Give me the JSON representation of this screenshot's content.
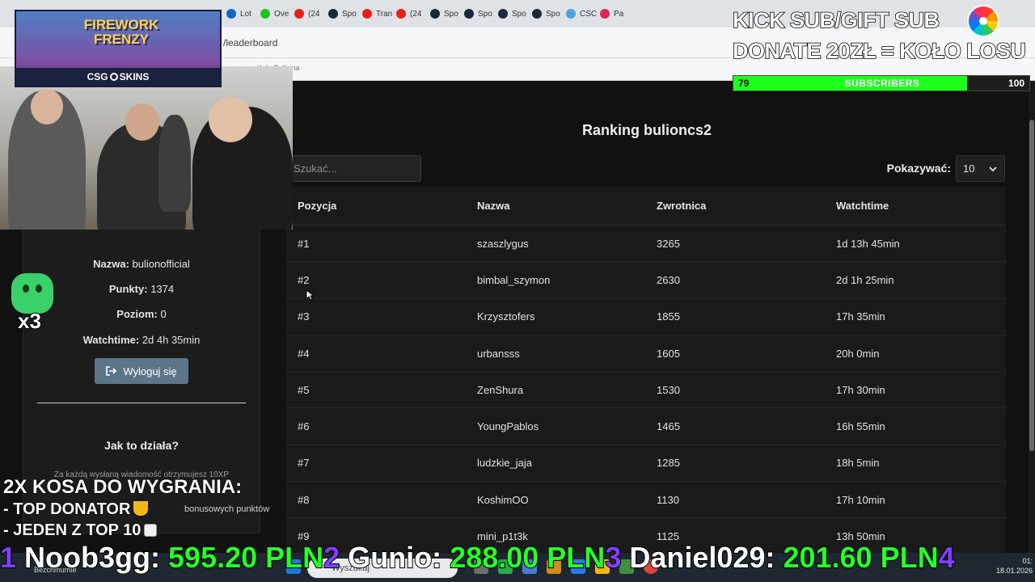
{
  "browser": {
    "tabs": [
      {
        "label": "Lot",
        "color": "#1565c0"
      },
      {
        "label": "Ove",
        "color": "#21c21f"
      },
      {
        "label": "(24",
        "color": "#e62117"
      },
      {
        "label": "Spo",
        "color": "#1b2838"
      },
      {
        "label": "Tran",
        "color": "#e62117"
      },
      {
        "label": "(24",
        "color": "#e62117"
      },
      {
        "label": "Spo",
        "color": "#1b2838"
      },
      {
        "label": "Spo",
        "color": "#1b2838"
      },
      {
        "label": "Spo",
        "color": "#1b2838"
      },
      {
        "label": "Spo",
        "color": "#1b2838"
      },
      {
        "label": "CSC",
        "color": "#4aa3df"
      },
      {
        "label": "Pa",
        "color": "#e0245e"
      }
    ],
    "url": "/leaderboard",
    "bookmark": "Kolo Bulliona"
  },
  "profile": {
    "name_label": "Nazwa:",
    "name_value": "bulionofficial",
    "points_label": "Punkty:",
    "points_value": "1374",
    "level_label": "Poziom:",
    "level_value": "0",
    "watchtime_label": "Watchtime:",
    "watchtime_value": "2d 4h 35min",
    "logout_label": "Wyloguj się",
    "how_title": "Jak to działa?",
    "how_text": "Za każdą wysłaną wiadomość otrzymujesz 10XP",
    "how_text2": "bonusowych punktów"
  },
  "ranking": {
    "title": "Ranking bulioncs2",
    "search_placeholder": "Szukać...",
    "show_label": "Pokazywać:",
    "show_value": "10",
    "columns": [
      "Pozycja",
      "Nazwa",
      "Zwrotnica",
      "Watchtime"
    ],
    "rows": [
      {
        "pos": "#1",
        "name": "szaszlygus",
        "points": "3265",
        "time": "1d 13h 45min"
      },
      {
        "pos": "#2",
        "name": "bimbal_szymon",
        "points": "2630",
        "time": "2d 1h 25min"
      },
      {
        "pos": "#3",
        "name": "Krzysztofers",
        "points": "1855",
        "time": "17h 35min"
      },
      {
        "pos": "#4",
        "name": "urbansss",
        "points": "1605",
        "time": "20h 0min"
      },
      {
        "pos": "#5",
        "name": "ZenShura",
        "points": "1530",
        "time": "17h 30min"
      },
      {
        "pos": "#6",
        "name": "YoungPablos",
        "points": "1465",
        "time": "16h 55min"
      },
      {
        "pos": "#7",
        "name": "ludzkie_jaja",
        "points": "1285",
        "time": "18h 5min"
      },
      {
        "pos": "#8",
        "name": "KoshimOO",
        "points": "1130",
        "time": "17h 10min"
      },
      {
        "pos": "#9",
        "name": "mini_p1t3k",
        "points": "1125",
        "time": "13h 50min"
      }
    ]
  },
  "overlay": {
    "promo_title": "FIREWORK FRENZY",
    "promo_brand": "CSG",
    "promo_brand2": "SKINS",
    "kick_line1": "KICK SUB/GIFT SUB",
    "kick_line2": "DONATE 20ZŁ = KOŁO LOSU",
    "sub_current": "79",
    "sub_label": "SUBSCRIBERS",
    "sub_max": "100",
    "sub_fraction": 0.79,
    "multiplier": "x3",
    "prize_title": "2X KOSA DO WYGRANIA:",
    "prize_line1": "- TOP DONATOR",
    "prize_line2": "- JEDEN Z TOP 10",
    "ticker": [
      {
        "rank": "1",
        "name": "Noob3gg:",
        "amount": "595.20 PLN"
      },
      {
        "rank": "2",
        "name": "Gunio:",
        "amount": "288.00 PLN"
      },
      {
        "rank": "3",
        "name": "Daniel029:",
        "amount": "201.60 PLN"
      },
      {
        "rank": "4",
        "name": "",
        "amount": ""
      }
    ]
  },
  "taskbar": {
    "weather": "Bezchmurnie",
    "search": "Wyszukaj",
    "time": "01:",
    "date": "18.01.2026"
  },
  "colors": {
    "accent_green": "#27ff2a",
    "rank_purple": "#7f3fff",
    "logout_button": "#5d7589"
  }
}
